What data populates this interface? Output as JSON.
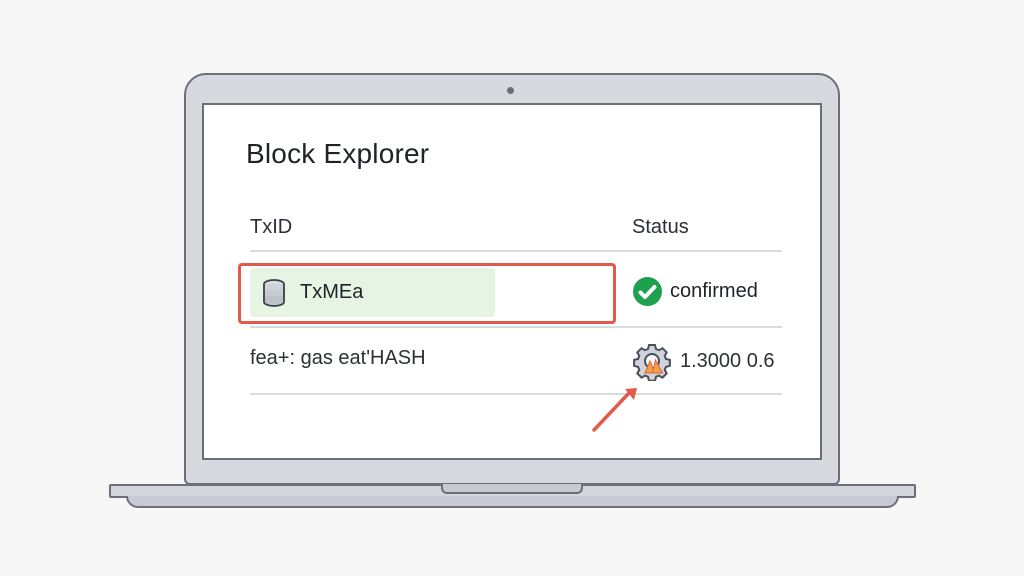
{
  "app": {
    "title": "Block Explorer"
  },
  "table": {
    "headers": {
      "txid": "TxID",
      "status": "Status"
    },
    "rows": [
      {
        "txid": "TxMEa",
        "status": "confirmed",
        "icon": "database-icon",
        "status_icon": "checkmark-circle-icon"
      },
      {
        "txid": "fea+: gas eat'HASH",
        "status": "1.3000 0.6",
        "status_icon": "gear-warning-icon"
      }
    ]
  },
  "colors": {
    "highlight_border": "#e25b4a",
    "highlight_fill": "#e6f4e4",
    "confirmed_green": "#1ea04f",
    "arrow": "#e25b4a",
    "warning_orange": "#f0a340"
  }
}
